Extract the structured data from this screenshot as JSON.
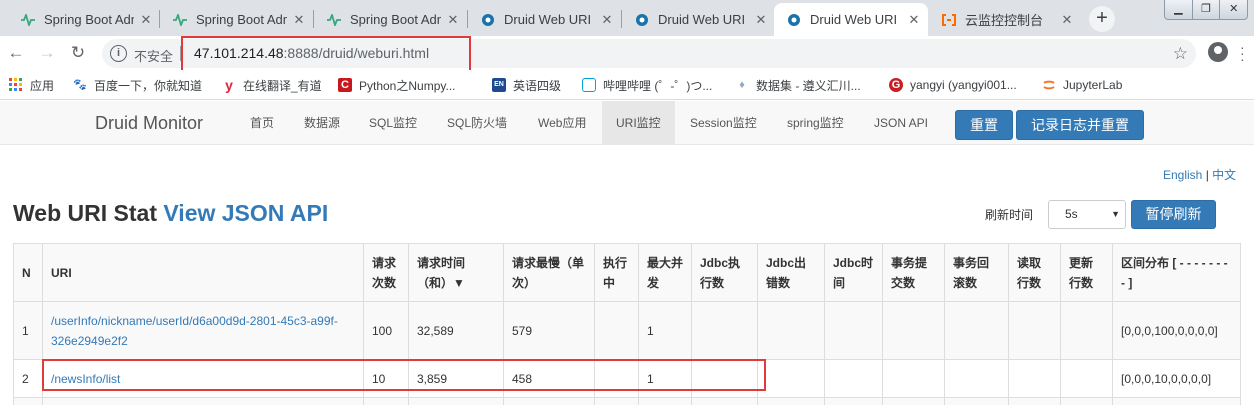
{
  "browser": {
    "tabs": [
      {
        "title": "Spring Boot Admin",
        "icon": "spring-boot-admin-icon",
        "active": false
      },
      {
        "title": "Spring Boot Admin",
        "icon": "spring-boot-admin-icon",
        "active": false
      },
      {
        "title": "Spring Boot Admin",
        "icon": "spring-boot-admin-icon",
        "active": false
      },
      {
        "title": "Druid Web URI",
        "icon": "druid-icon",
        "active": false
      },
      {
        "title": "Druid Web URI",
        "icon": "druid-icon",
        "active": false
      },
      {
        "title": "Druid Web URI",
        "icon": "druid-icon",
        "active": true
      },
      {
        "title": "云监控控制台",
        "icon": "aliyun-icon",
        "active": false
      }
    ],
    "insecure_label": "不安全",
    "url_host": "47.101.214.48",
    "url_rest": ":8888/druid/weburi.html",
    "bookmarks": [
      {
        "label": "应用",
        "icon": "apps-grid-icon"
      },
      {
        "label": "百度一下，你就知道",
        "icon": "baidu-icon"
      },
      {
        "label": "在线翻译_有道",
        "icon": "youdao-icon"
      },
      {
        "label": "Python之Numpy...",
        "icon": "csdn-icon"
      },
      {
        "label": "英语四级",
        "icon": "book-icon"
      },
      {
        "label": "哔哩哔哩 (゜-゜)つ...",
        "icon": "bilibili-icon"
      },
      {
        "label": "数据集 - 遵义汇川...",
        "icon": "dataset-icon"
      },
      {
        "label": "yangyi (yangyi001...",
        "icon": "gitee-icon"
      },
      {
        "label": "JupyterLab",
        "icon": "jupyter-icon"
      }
    ]
  },
  "colors": {
    "accent": "#337ab7",
    "highlight_box": "#e23a3a"
  },
  "druid": {
    "brand": "Druid Monitor",
    "nav": [
      "首页",
      "数据源",
      "SQL监控",
      "SQL防火墙",
      "Web应用",
      "URI监控",
      "Session监控",
      "spring监控",
      "JSON API"
    ],
    "active_nav": "URI监控",
    "reset_label": "重置",
    "log_reset_label": "记录日志并重置",
    "lang_en": "English",
    "lang_sep": "|",
    "lang_zh": "中文",
    "title": "Web URI Stat",
    "json_link": "View JSON API",
    "refresh_label": "刷新时间",
    "refresh_value": "5s",
    "pause_label": "暂停刷新"
  },
  "table": {
    "headers": [
      "N",
      "URI",
      "请求次数",
      "请求时间（和）▼",
      "请求最慢（单次）",
      "执行中",
      "最大并发",
      "Jdbc执行数",
      "Jdbc出错数",
      "Jdbc时间",
      "事务提交数",
      "事务回滚数",
      "读取行数",
      "更新行数",
      "区间分布 [ - - - - - - - - ]"
    ],
    "rows": [
      [
        "1",
        "/userInfo/nickname/userId/d6a00d9d-2801-45c3-a99f-326e2949e2f2",
        "100",
        "32,589",
        "579",
        "",
        "1",
        "",
        "",
        "",
        "",
        "",
        "",
        "",
        "[0,0,0,100,0,0,0,0]"
      ],
      [
        "2",
        "/newsInfo/list",
        "10",
        "3,859",
        "458",
        "",
        "1",
        "",
        "",
        "",
        "",
        "",
        "",
        "",
        "[0,0,0,10,0,0,0,0]"
      ]
    ]
  }
}
